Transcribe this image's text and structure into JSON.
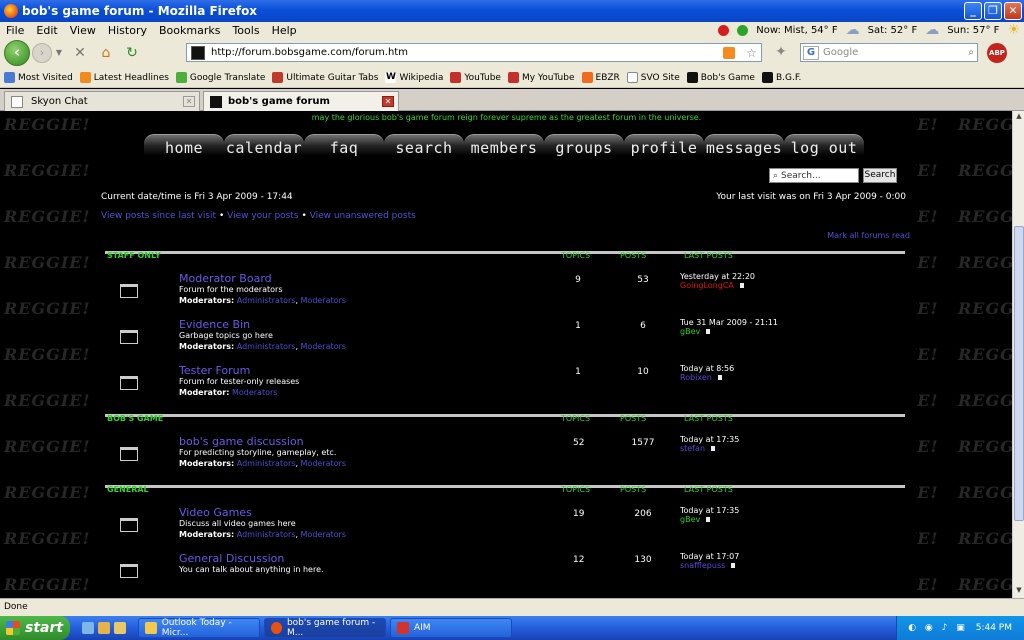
{
  "window": {
    "title": "bob's game forum - Mozilla Firefox"
  },
  "menu": [
    "File",
    "Edit",
    "View",
    "History",
    "Bookmarks",
    "Tools",
    "Help"
  ],
  "weather": {
    "now": "Now: Mist, 54° F",
    "sat": "Sat: 52° F",
    "sun": "Sun: 57° F"
  },
  "navbar": {
    "url": "http://forum.bobsgame.com/forum.htm",
    "search_placeholder": "Google",
    "abp": "ABP"
  },
  "bookmarks": [
    "Most Visited",
    "Latest Headlines",
    "Google Translate",
    "Ultimate Guitar Tabs",
    "Wikipedia",
    "YouTube",
    "My YouTube",
    "EBZR",
    "SVO Site",
    "Bob's Game",
    "B.G.F."
  ],
  "tabs": [
    {
      "label": "Skyon Chat"
    },
    {
      "label": "bob's game forum"
    }
  ],
  "watermark": "REGGIE!",
  "forum": {
    "slogan": "may the glorious bob's game forum reign forever supreme as the greatest forum in the universe.",
    "nav": [
      "home",
      "calendar",
      "faq",
      "search",
      "members",
      "groups",
      "profile",
      "messages",
      "log out"
    ],
    "search_placeholder": "Search...",
    "search_button": "Search",
    "current_time": "Current date/time is Fri 3 Apr 2009 - 17:44",
    "last_visit": "Your last visit was on Fri 3 Apr 2009 - 0:00",
    "quick_links": [
      "View posts since last visit",
      "View your posts",
      "View unanswered posts"
    ],
    "mark_read": "Mark all forums read",
    "columns": [
      "TOPICS",
      "POSTS",
      "LAST POSTS"
    ],
    "categories": [
      {
        "name": "STAFF ONLY",
        "forums": [
          {
            "title": "Moderator Board",
            "desc": "Forum for the moderators",
            "mods_label": "Moderators:",
            "mods": [
              "Administrators",
              "Moderators"
            ],
            "topics": "9",
            "posts": "53",
            "last_time": "Yesterday at 22:20",
            "last_user": "GoingLongCA",
            "user_color": "#e01414"
          },
          {
            "title": "Evidence Bin",
            "desc": "Garbage topics go here",
            "mods_label": "Moderators:",
            "mods": [
              "Administrators",
              "Moderators"
            ],
            "topics": "1",
            "posts": "6",
            "last_time": "Tue 31 Mar 2009 - 21:11",
            "last_user": "gBev",
            "user_color": "#2ccf2c"
          },
          {
            "title": "Tester Forum",
            "desc": "Forum for tester-only releases",
            "mods_label": "Moderator:",
            "mods": [
              "Moderators"
            ],
            "topics": "1",
            "posts": "10",
            "last_time": "Today at 8:56",
            "last_user": "Robixen",
            "user_color": "#5a4ad6"
          }
        ]
      },
      {
        "name": "BOB'S GAME",
        "forums": [
          {
            "title": "bob's game discussion",
            "desc": "For predicting storyline, gameplay, etc.",
            "mods_label": "Moderators:",
            "mods": [
              "Administrators",
              "Moderators"
            ],
            "topics": "52",
            "posts": "1577",
            "last_time": "Today at 17:35",
            "last_user": "stefan",
            "user_color": "#5a4ad6"
          }
        ]
      },
      {
        "name": "GENERAL",
        "forums": [
          {
            "title": "Video Games",
            "desc": "Discuss all video games here",
            "mods_label": "Moderators:",
            "mods": [
              "Administrators",
              "Moderators"
            ],
            "topics": "19",
            "posts": "206",
            "last_time": "Today at 17:35",
            "last_user": "gBev",
            "user_color": "#2ccf2c"
          },
          {
            "title": "General Discussion",
            "desc": "You can talk about anything in here.",
            "mods_label": "",
            "mods": [],
            "topics": "12",
            "posts": "130",
            "last_time": "Today at 17:07",
            "last_user": "snafflepuss",
            "user_color": "#5a4ad6"
          }
        ]
      }
    ]
  },
  "status": "Done",
  "taskbar": {
    "start": "start",
    "items": [
      "Outlook Today - Micr...",
      "bob's game forum - M...",
      "AIM"
    ],
    "clock": "5:44 PM"
  }
}
